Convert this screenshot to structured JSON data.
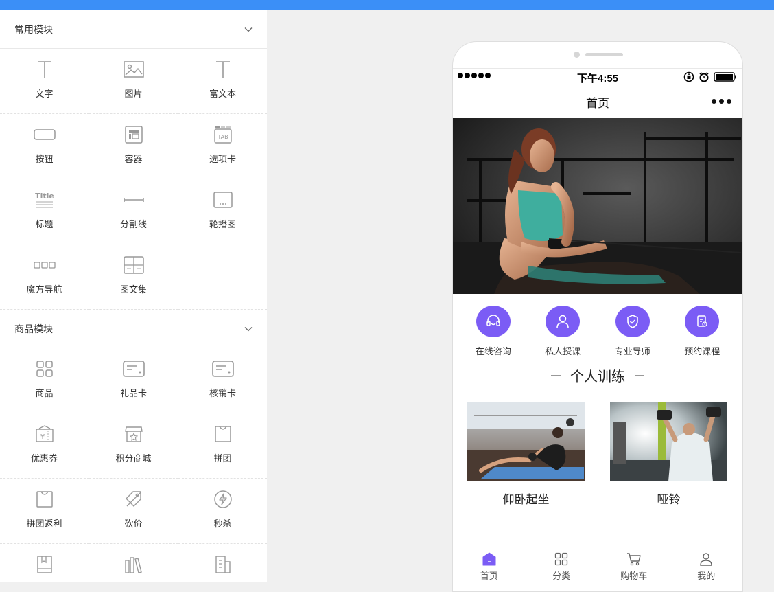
{
  "colors": {
    "topbar": "#3b8ff7",
    "accent": "#7b5cf5"
  },
  "common_section": {
    "title": "常用模块",
    "items": [
      {
        "label": "文字",
        "icon": "text-icon"
      },
      {
        "label": "图片",
        "icon": "image-icon"
      },
      {
        "label": "富文本",
        "icon": "rich-text-icon"
      },
      {
        "label": "按钮",
        "icon": "button-icon"
      },
      {
        "label": "容器",
        "icon": "container-icon"
      },
      {
        "label": "选项卡",
        "icon": "tab-icon"
      },
      {
        "label": "标题",
        "icon": "title-icon"
      },
      {
        "label": "分割线",
        "icon": "divider-icon"
      },
      {
        "label": "轮播图",
        "icon": "carousel-icon"
      },
      {
        "label": "魔方导航",
        "icon": "cube-nav-icon"
      },
      {
        "label": "图文集",
        "icon": "image-text-icon"
      }
    ]
  },
  "goods_section": {
    "title": "商品模块",
    "items": [
      {
        "label": "商品",
        "icon": "goods-icon"
      },
      {
        "label": "礼品卡",
        "icon": "gift-card-icon"
      },
      {
        "label": "核销卡",
        "icon": "verify-card-icon"
      },
      {
        "label": "优惠券",
        "icon": "coupon-icon"
      },
      {
        "label": "积分商城",
        "icon": "points-mall-icon"
      },
      {
        "label": "拼团",
        "icon": "group-buy-icon"
      },
      {
        "label": "拼团返利",
        "icon": "group-rebate-icon"
      },
      {
        "label": "砍价",
        "icon": "bargain-icon"
      },
      {
        "label": "秒杀",
        "icon": "flash-sale-icon"
      },
      {
        "label": "",
        "icon": "book-icon"
      },
      {
        "label": "",
        "icon": "books-icon"
      },
      {
        "label": "",
        "icon": "document-icon"
      }
    ]
  },
  "phone": {
    "status_time": "下午4:55",
    "page_title": "首页",
    "quick_nav": [
      {
        "label": "在线咨询",
        "icon": "headset-icon"
      },
      {
        "label": "私人授课",
        "icon": "person-icon"
      },
      {
        "label": "专业导师",
        "icon": "shield-check-icon"
      },
      {
        "label": "预约课程",
        "icon": "schedule-icon"
      }
    ],
    "section_title": "个人训练",
    "cards": [
      {
        "title": "仰卧起坐"
      },
      {
        "title": "哑铃"
      }
    ],
    "tabs": [
      {
        "label": "首页",
        "icon": "home-icon",
        "active": true
      },
      {
        "label": "分类",
        "icon": "category-icon"
      },
      {
        "label": "购物车",
        "icon": "cart-icon"
      },
      {
        "label": "我的",
        "icon": "profile-icon"
      }
    ]
  }
}
